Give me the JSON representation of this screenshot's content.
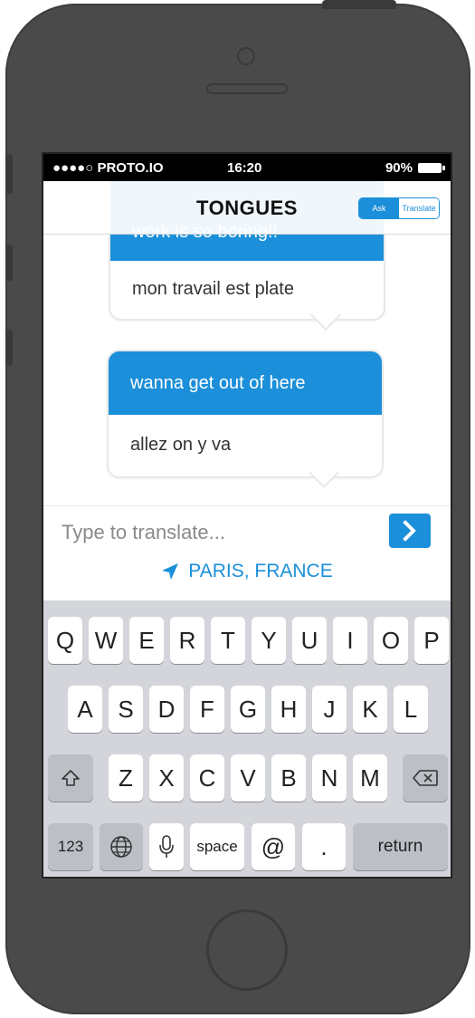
{
  "status_bar": {
    "carrier": "●●●●○ PROTO.IO",
    "time": "16:20",
    "battery": "90%"
  },
  "nav": {
    "title": "TONGUES",
    "segments": [
      {
        "label": "Ask",
        "selected": true
      },
      {
        "label": "Translate",
        "selected": false
      }
    ]
  },
  "messages": [
    {
      "original": "work is so boring!!",
      "translation": "mon travail est plate"
    },
    {
      "original": "wanna get out of here",
      "translation": "allez on y va"
    }
  ],
  "input": {
    "placeholder": "Type to translate...",
    "send_icon": "chevron-right-icon"
  },
  "location": {
    "icon": "location-arrow-icon",
    "label": "PARIS, FRANCE"
  },
  "keyboard": {
    "row1": [
      "Q",
      "W",
      "E",
      "R",
      "T",
      "Y",
      "U",
      "I",
      "O",
      "P"
    ],
    "row2": [
      "A",
      "S",
      "D",
      "F",
      "G",
      "H",
      "J",
      "K",
      "L"
    ],
    "row3": [
      "Z",
      "X",
      "C",
      "V",
      "B",
      "N",
      "M"
    ],
    "shift_icon": "shift-icon",
    "delete_icon": "delete-icon",
    "numbers_label": "123",
    "globe_icon": "globe-icon",
    "mic_icon": "microphone-icon",
    "space_label": "space",
    "at_label": "@",
    "period_label": ".",
    "return_label": "return"
  },
  "colors": {
    "accent": "#1b8fd9",
    "device": "#4a4a4a",
    "keyboard_bg": "#d3d5da"
  }
}
